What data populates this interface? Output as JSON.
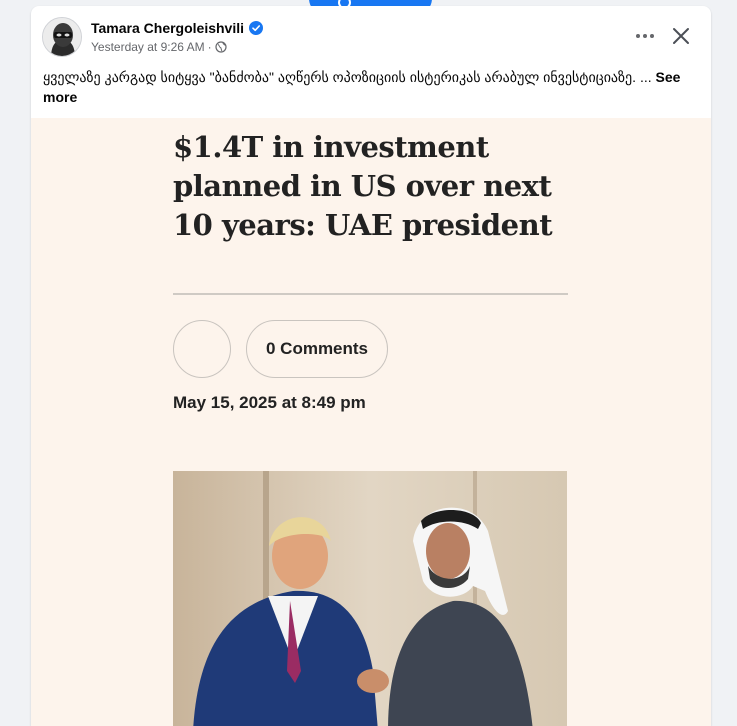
{
  "post": {
    "author": "Tamara Chergoleishvili",
    "timestamp": "Yesterday at 9:26 AM",
    "meta_separator": "·",
    "text": "ყველაზე კარგად სიტყვა \"ბანძობა\" აღწერს ოპოზიციის ისტერიკას არაბულ ინვესტიციაზე. ...",
    "see_more": "See more"
  },
  "article": {
    "headline": "$1.4T in investment planned in US over next 10 years: UAE president",
    "comments_label": "0 Comments",
    "date": "May 15, 2025 at 8:49 pm"
  },
  "icons": {
    "verified": "verified-badge-icon",
    "privacy": "globe-icon",
    "more": "more-options-icon",
    "close": "close-icon"
  },
  "colors": {
    "accent": "#1877f2",
    "article_background": "#fdf4ec",
    "meta_text": "#65676b"
  }
}
